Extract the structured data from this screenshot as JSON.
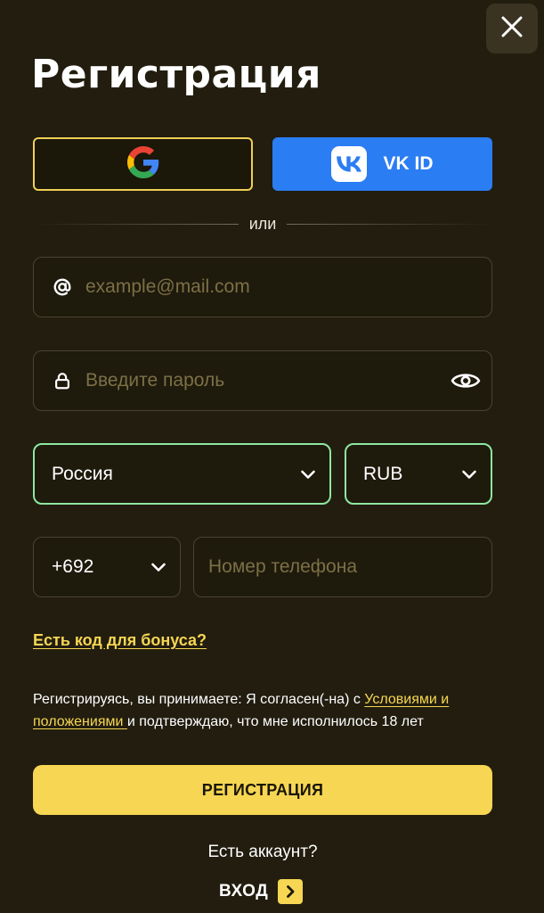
{
  "header": {
    "title": "Регистрация"
  },
  "social": {
    "google_icon": "google-logo-icon",
    "vk_label": "VK ID",
    "vk_icon": "vk-logo-icon"
  },
  "divider": {
    "text": "или"
  },
  "form": {
    "email": {
      "placeholder": "example@mail.com",
      "value": "",
      "icon": "at-sign-icon"
    },
    "password": {
      "placeholder": "Введите пароль",
      "value": "",
      "icon": "lock-icon",
      "toggle_icon": "eye-icon"
    },
    "country": {
      "value": "Россия"
    },
    "currency": {
      "value": "RUB"
    },
    "phone_code": {
      "value": "+692"
    },
    "phone": {
      "placeholder": "Номер телефона",
      "value": ""
    }
  },
  "bonus": {
    "link": "Есть код для бонуса?"
  },
  "terms": {
    "prefix": "Регистрируясь, вы принимаете: Я согласен(-на) с ",
    "link": "Условиями и положениями ",
    "suffix": " и подтверждаю, что мне исполнилось 18 лет"
  },
  "actions": {
    "submit": "РЕГИСТРАЦИЯ",
    "have_account": "Есть аккаунт?",
    "login": "ВХОД"
  },
  "colors": {
    "background": "#221d0f",
    "accent": "#f6d653",
    "vk_blue": "#2b7df3",
    "active_border": "#8fe7a1"
  }
}
